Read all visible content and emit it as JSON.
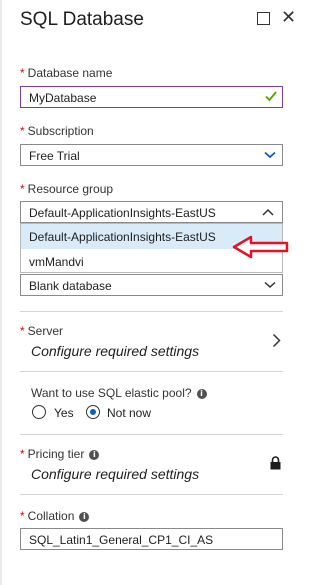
{
  "panel": {
    "title": "SQL Database"
  },
  "form": {
    "database_name": {
      "label": "Database name",
      "value": "MyDatabase"
    },
    "subscription": {
      "label": "Subscription",
      "value": "Free Trial"
    },
    "resource_group": {
      "label": "Resource group",
      "value": "Default-ApplicationInsights-EastUS",
      "options": [
        "Default-ApplicationInsights-EastUS",
        "vmMandvi"
      ]
    },
    "source": {
      "value": "Blank database"
    },
    "server": {
      "label": "Server",
      "value": "Configure required settings"
    },
    "elastic_pool": {
      "label": "Want to use SQL elastic pool?",
      "yes": "Yes",
      "no": "Not now",
      "selected": "Not now"
    },
    "pricing_tier": {
      "label": "Pricing tier",
      "value": "Configure required settings"
    },
    "collation": {
      "label": "Collation",
      "value": "SQL_Latin1_General_CP1_CI_AS"
    }
  },
  "colors": {
    "required_star": "#c50f1f",
    "focus_border": "#7a3e9d",
    "valid_check": "#57a300",
    "dropdown_chevron": "#0f5ebd",
    "selected_option_bg": "#d9ebf9",
    "annotation_arrow": "#e81123"
  },
  "icons": {
    "restore": "square-icon",
    "close": "close-icon",
    "check": "checkmark-icon",
    "info": "info-icon",
    "lock": "lock-icon",
    "chevron_right": "chevron-right-icon",
    "annotation": "red-arrow-icon"
  }
}
